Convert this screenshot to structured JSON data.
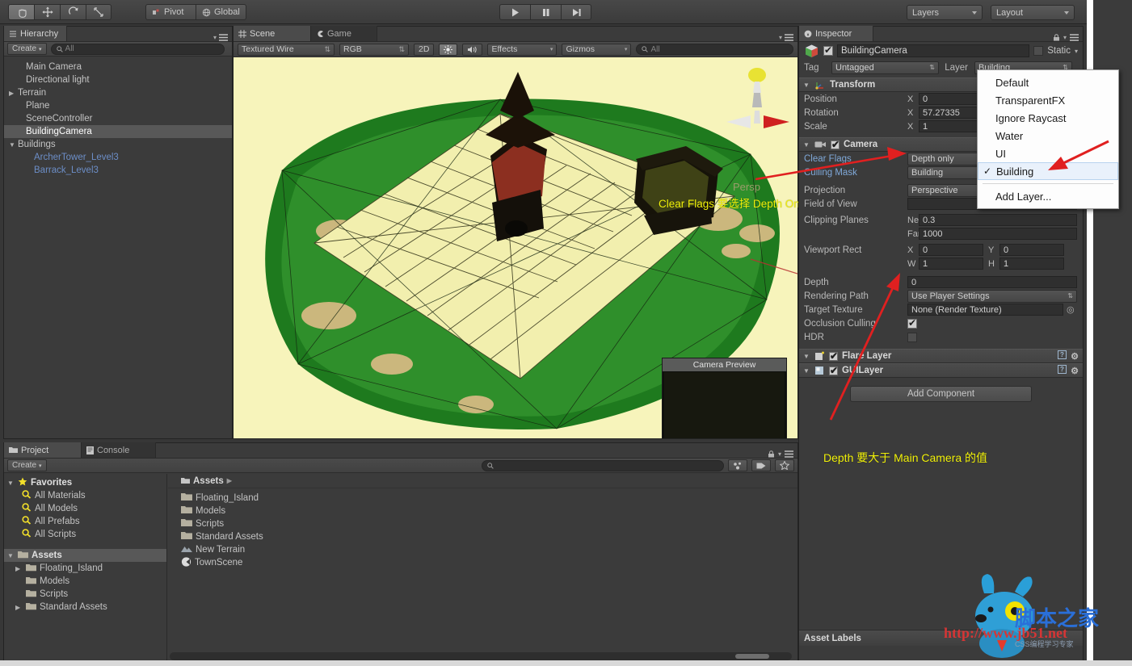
{
  "toolbar": {
    "transform_tools": [
      {
        "name": "hand-tool",
        "label": ""
      },
      {
        "name": "move-tool",
        "label": ""
      },
      {
        "name": "rotate-tool",
        "label": ""
      },
      {
        "name": "scale-tool",
        "label": ""
      }
    ],
    "pivot_label": "Pivot",
    "global_label": "Global",
    "play_label": "▶",
    "pause_label": "❚❚",
    "step_label": "▶❙",
    "layers_label": "Layers",
    "layout_label": "Layout"
  },
  "hierarchy": {
    "tab_label": "Hierarchy",
    "create_label": "Create",
    "search_placeholder": "All",
    "items": [
      {
        "label": "Main Camera",
        "indent": 1,
        "arrow": "",
        "prefab": false,
        "selected": false
      },
      {
        "label": "Directional light",
        "indent": 1,
        "arrow": "",
        "prefab": false,
        "selected": false
      },
      {
        "label": "Terrain",
        "indent": 0,
        "arrow": "▶",
        "prefab": false,
        "selected": false
      },
      {
        "label": "Plane",
        "indent": 1,
        "arrow": "",
        "prefab": false,
        "selected": false
      },
      {
        "label": "SceneController",
        "indent": 1,
        "arrow": "",
        "prefab": false,
        "selected": false
      },
      {
        "label": "BuildingCamera",
        "indent": 1,
        "arrow": "",
        "prefab": false,
        "selected": true
      },
      {
        "label": "Buildings",
        "indent": 0,
        "arrow": "▼",
        "prefab": false,
        "selected": false
      },
      {
        "label": "ArcherTower_Level3",
        "indent": 2,
        "arrow": "",
        "prefab": true,
        "selected": false
      },
      {
        "label": "Barrack_Level3",
        "indent": 2,
        "arrow": "",
        "prefab": true,
        "selected": false
      }
    ]
  },
  "scene": {
    "tab_scene": "Scene",
    "tab_game": "Game",
    "shading_mode": "Textured Wire",
    "color_mode": "RGB",
    "toggle_2d": "2D",
    "effects_label": "Effects",
    "gizmos_label": "Gizmos",
    "search_placeholder": "All",
    "persp_label": "Persp",
    "camera_preview_title": "Camera Preview",
    "annotation": "Clear Flags 要选择 Depth Only, Culling Mask 选择 Building"
  },
  "project": {
    "tab_project": "Project",
    "tab_console": "Console",
    "create_label": "Create",
    "search_placeholder": "",
    "favorites_label": "Favorites",
    "favorites": [
      "All Materials",
      "All Models",
      "All Prefabs",
      "All Scripts"
    ],
    "assets_label": "Assets",
    "tree_assets": [
      {
        "label": "Floating_Island",
        "arrow": "▶"
      },
      {
        "label": "Models",
        "arrow": ""
      },
      {
        "label": "Scripts",
        "arrow": ""
      },
      {
        "label": "Standard Assets",
        "arrow": "▶"
      }
    ],
    "breadcrumb": "Assets",
    "contents": [
      {
        "label": "Floating_Island",
        "icon": "folder-icon"
      },
      {
        "label": "Models",
        "icon": "folder-icon"
      },
      {
        "label": "Scripts",
        "icon": "folder-icon"
      },
      {
        "label": "Standard Assets",
        "icon": "folder-icon"
      },
      {
        "label": "New Terrain",
        "icon": "terrain-icon"
      },
      {
        "label": "TownScene",
        "icon": "scene-icon"
      }
    ]
  },
  "inspector": {
    "tab_label": "Inspector",
    "object_name": "BuildingCamera",
    "static_label": "Static",
    "tag_label": "Tag",
    "tag_value": "Untagged",
    "layer_label": "Layer",
    "layer_value": "Building",
    "transform": {
      "title": "Transform",
      "rows": [
        {
          "label": "Position",
          "x": "0",
          "y": ""
        },
        {
          "label": "Rotation",
          "x": "57.27335",
          "y": ""
        },
        {
          "label": "Scale",
          "x": "1",
          "y": ""
        }
      ]
    },
    "camera": {
      "title": "Camera",
      "clear_flags_label": "Clear Flags",
      "clear_flags_value": "Depth only",
      "culling_mask_label": "Culling Mask",
      "culling_mask_value": "Building",
      "projection_label": "Projection",
      "projection_value": "Perspective",
      "fov_label": "Field of View",
      "clipping_label": "Clipping Planes",
      "near_label": "Near",
      "near_value": "0.3",
      "far_label": "Far",
      "far_value": "1000",
      "viewport_label": "Viewport Rect",
      "viewport_x_label": "X",
      "viewport_x": "0",
      "viewport_y_label": "Y",
      "viewport_y": "0",
      "viewport_w_label": "W",
      "viewport_w": "1",
      "viewport_h_label": "H",
      "viewport_h": "1",
      "depth_label": "Depth",
      "depth_value": "0",
      "rendering_path_label": "Rendering Path",
      "rendering_path_value": "Use Player Settings",
      "target_texture_label": "Target Texture",
      "target_texture_value": "None (Render Texture)",
      "occlusion_label": "Occlusion Culling",
      "hdr_label": "HDR"
    },
    "flare_layer_title": "Flare Layer",
    "gui_layer_title": "GUILayer",
    "add_component_label": "Add Component",
    "annotation": "Depth 要大于 Main Camera 的值",
    "asset_labels": "Asset Labels"
  },
  "layer_menu": {
    "items": [
      {
        "label": "Default",
        "checked": false
      },
      {
        "label": "TransparentFX",
        "checked": false
      },
      {
        "label": "Ignore Raycast",
        "checked": false
      },
      {
        "label": "Water",
        "checked": false
      },
      {
        "label": "UI",
        "checked": false
      },
      {
        "label": "Building",
        "checked": true
      }
    ],
    "add_layer_label": "Add Layer..."
  },
  "watermark": {
    "url": "http://www.jb51.net",
    "cn_title": "脚本之家",
    "tagline": "CSS编程学习专家"
  },
  "colors": {
    "panel_bg": "#3b3b3b",
    "accent_yellow": "#f2f20a",
    "arrow_red": "#e02020",
    "prefab_blue": "#6c8ec7",
    "selection": "#585858"
  }
}
